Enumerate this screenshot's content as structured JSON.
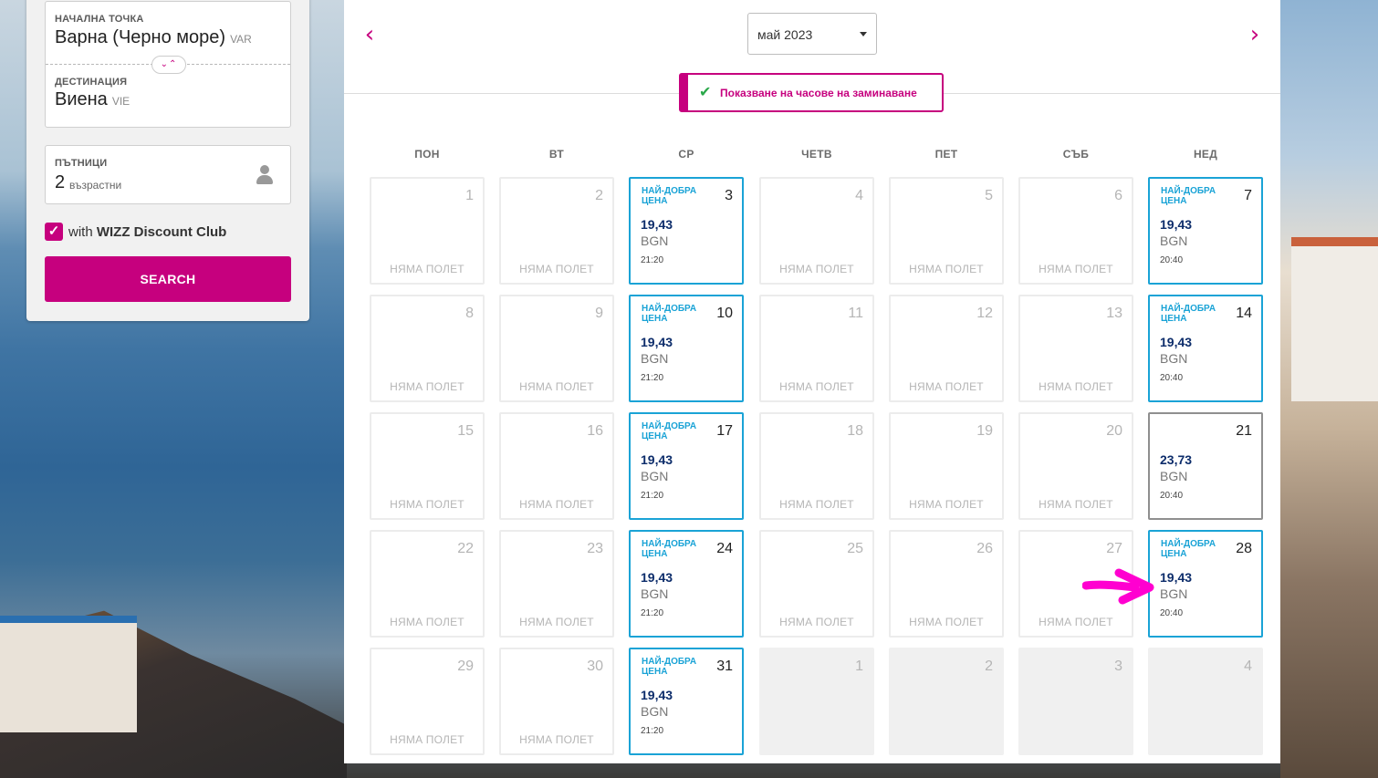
{
  "search": {
    "origin_label": "НАЧАЛНА ТОЧКА",
    "origin_city": "Варна (Черно море)",
    "origin_code": "VAR",
    "destination_label": "ДЕСТИНАЦИЯ",
    "destination_city": "Виена",
    "destination_code": "VIE",
    "swap_icon": "⌄⌃",
    "passengers_label": "ПЪТНИЦИ",
    "passengers_count": "2",
    "passengers_text": "възрастни",
    "club_prefix": "with ",
    "club_name": "WIZZ Discount Club",
    "club_checked": true,
    "search_label": "SEARCH"
  },
  "calendar": {
    "month": "май 2023",
    "prev_icon": "chevron-left-icon",
    "next_icon": "chevron-right-icon",
    "show_times_label": "Показване на часове на заминаване",
    "weekdays": [
      "ПОН",
      "ВТ",
      "СР",
      "ЧЕТВ",
      "ПЕТ",
      "СЪБ",
      "НЕД"
    ],
    "no_flight_label": "НЯМА ПОЛЕТ",
    "best_price_label": "НАЙ-ДОБРА ЦЕНА",
    "currency": "BGN",
    "weeks": [
      [
        {
          "day": "1",
          "state": "none"
        },
        {
          "day": "2",
          "state": "none"
        },
        {
          "day": "3",
          "state": "best",
          "price": "19,43",
          "time": "21:20"
        },
        {
          "day": "4",
          "state": "none"
        },
        {
          "day": "5",
          "state": "none"
        },
        {
          "day": "6",
          "state": "none"
        },
        {
          "day": "7",
          "state": "best",
          "price": "19,43",
          "time": "20:40"
        }
      ],
      [
        {
          "day": "8",
          "state": "none"
        },
        {
          "day": "9",
          "state": "none"
        },
        {
          "day": "10",
          "state": "best",
          "price": "19,43",
          "time": "21:20"
        },
        {
          "day": "11",
          "state": "none"
        },
        {
          "day": "12",
          "state": "none"
        },
        {
          "day": "13",
          "state": "none"
        },
        {
          "day": "14",
          "state": "best",
          "price": "19,43",
          "time": "20:40"
        }
      ],
      [
        {
          "day": "15",
          "state": "none"
        },
        {
          "day": "16",
          "state": "none"
        },
        {
          "day": "17",
          "state": "best",
          "price": "19,43",
          "time": "21:20"
        },
        {
          "day": "18",
          "state": "none"
        },
        {
          "day": "19",
          "state": "none"
        },
        {
          "day": "20",
          "state": "none"
        },
        {
          "day": "21",
          "state": "flight",
          "price": "23,73",
          "time": "20:40"
        }
      ],
      [
        {
          "day": "22",
          "state": "none"
        },
        {
          "day": "23",
          "state": "none"
        },
        {
          "day": "24",
          "state": "best",
          "price": "19,43",
          "time": "21:20"
        },
        {
          "day": "25",
          "state": "none"
        },
        {
          "day": "26",
          "state": "none"
        },
        {
          "day": "27",
          "state": "none"
        },
        {
          "day": "28",
          "state": "best",
          "price": "19,43",
          "time": "20:40"
        }
      ],
      [
        {
          "day": "29",
          "state": "none"
        },
        {
          "day": "30",
          "state": "none"
        },
        {
          "day": "31",
          "state": "best",
          "price": "19,43",
          "time": "21:20"
        },
        {
          "day": "1",
          "state": "outside"
        },
        {
          "day": "2",
          "state": "outside"
        },
        {
          "day": "3",
          "state": "outside"
        },
        {
          "day": "4",
          "state": "outside"
        }
      ]
    ]
  },
  "colors": {
    "brand": "#c6007e",
    "best_border": "#1aa3d6",
    "price_text": "#0d2d6b",
    "annotation": "#ff00d0"
  }
}
